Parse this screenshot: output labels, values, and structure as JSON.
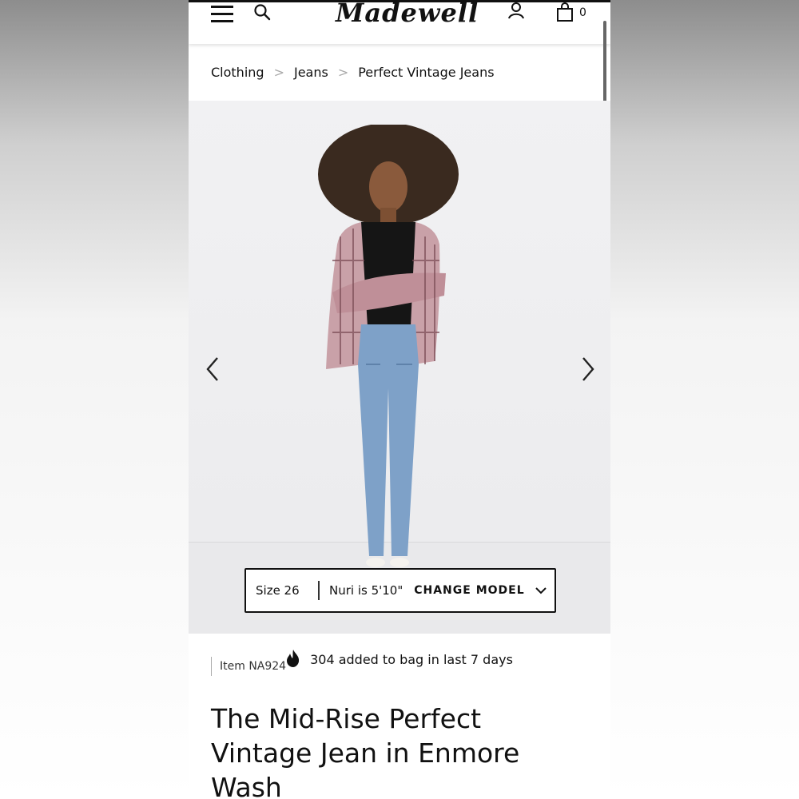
{
  "header": {
    "logo_text": "Madewell",
    "bag_count": "0",
    "icons": [
      "menu-icon",
      "search-icon",
      "account-icon",
      "bag-icon"
    ]
  },
  "breadcrumb": {
    "items": [
      "Clothing",
      "Jeans",
      "Perfect Vintage Jeans"
    ],
    "separator": ">"
  },
  "gallery": {
    "prev_icon": "chevron-left-icon",
    "next_icon": "chevron-right-icon"
  },
  "model_bar": {
    "size": "Size 26",
    "model_height": "Nuri is 5'10\"",
    "change_label": "CHANGE MODEL"
  },
  "product": {
    "item_number": "Item NA924",
    "bag_activity": "304 added to bag in last 7 days",
    "title": "The Mid-Rise Perfect Vintage Jean in Enmore Wash"
  },
  "colors": {
    "text": "#111111",
    "border": "#111111",
    "image_bg": "#efeff1"
  }
}
